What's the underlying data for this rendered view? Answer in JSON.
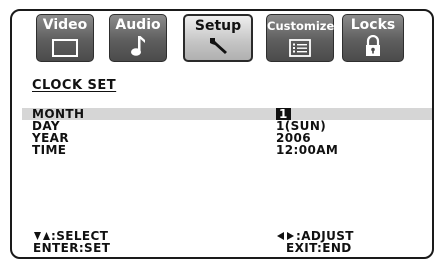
{
  "tabs": [
    {
      "label": "Video",
      "icon": "monitor-icon",
      "active": false
    },
    {
      "label": "Audio",
      "icon": "music-note-icon",
      "active": false
    },
    {
      "label": "Setup",
      "icon": "wrench-icon",
      "active": true
    },
    {
      "label": "Customize",
      "icon": "list-icon",
      "active": false
    },
    {
      "label": "Locks",
      "icon": "padlock-icon",
      "active": false
    }
  ],
  "section_title": "CLOCK SET",
  "rows": [
    {
      "label": "MONTH",
      "value": "1",
      "highlighted": true
    },
    {
      "label": "DAY",
      "value": "1(SUN)",
      "highlighted": false
    },
    {
      "label": "YEAR",
      "value": "2006",
      "highlighted": false
    },
    {
      "label": "TIME",
      "value": "12:00AM",
      "highlighted": false
    }
  ],
  "footer": {
    "select": ":SELECT",
    "set": "ENTER:SET",
    "adjust": ":ADJUST",
    "end": "EXIT:END"
  },
  "colors": {
    "tab_dark": "#5e5e5e",
    "tab_active": "#c4c4c4",
    "row_highlight": "#d6d6d6"
  }
}
